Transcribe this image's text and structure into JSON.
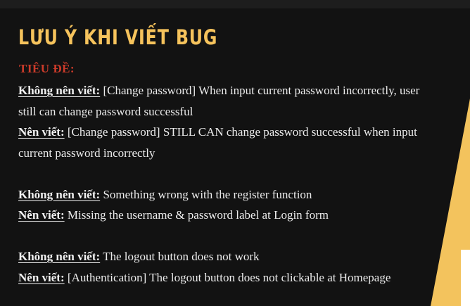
{
  "slide": {
    "title": "LƯU Ý KHI VIẾT BUG",
    "section_label": "TIÊU ĐỀ:",
    "examples": [
      {
        "bad_label": "Không nên viết:",
        "bad_text_1": " [Change password] When input current password incorrectly, user",
        "bad_text_2": "still can change password successful",
        "good_label": "Nên viết:",
        "good_text_1": " [Change password] STILL CAN change password successful when input",
        "good_text_2": "current password incorrectly"
      },
      {
        "bad_label": "Không nên viết:",
        "bad_text_1": " Something wrong with the register function",
        "good_label": "Nên viết:",
        "good_text_1": " Missing the username & password label at Login form"
      },
      {
        "bad_label": "Không nên viết:",
        "bad_text_1": " The logout button does not work",
        "good_label": "Nên viết:",
        "good_text_1": " [Authentication] The logout button does not clickable at Homepage"
      }
    ]
  },
  "colors": {
    "background": "#121212",
    "title": "#f6c35c",
    "section_label": "#cc3b2a",
    "body_text": "#ececec",
    "accent": "#f3c35d"
  }
}
